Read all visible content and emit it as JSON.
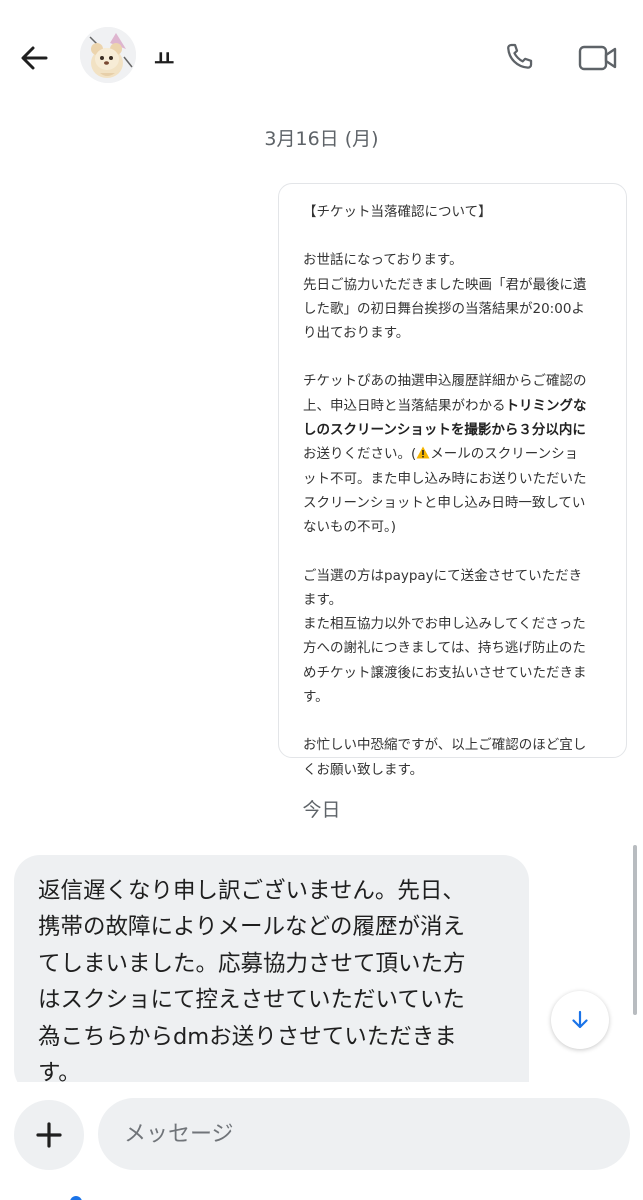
{
  "header": {
    "contact_name": "ㅛ",
    "back_icon": "arrow-left-icon",
    "call_icon": "phone-icon",
    "video_icon": "video-camera-icon"
  },
  "thread": {
    "date_1": "3月16日 (月)",
    "shared_message": {
      "title": "【チケット当落確認について】",
      "p1_l1": "お世話になっております。",
      "p1_l2": "先日ご協力いただきました映画「君が最後に遺",
      "p1_l3": "した歌」の初日舞台挨拶の当落結果が20:00よ",
      "p1_l4": "り出ております。",
      "p2_l1": "チケットぴあの抽選申込履歴詳細からご確認の",
      "p2_l2_a": "上、申込日時と当落結果がわかる",
      "p2_l2_b": "トリミングな",
      "p2_l3": "しのスクリーンショットを撮影から３分以内に",
      "p2_l4_a": "お送りください。(",
      "p2_l4_b": "メールのスクリーンショ",
      "p2_l5": "ット不可。また申し込み時にお送りいただいた",
      "p2_l6": "スクリーンショットと申し込み日時一致してい",
      "p2_l7": "ないもの不可。)",
      "p3_l1": "ご当選の方はpaypayにて送金させていただき",
      "p3_l2": "ます。",
      "p3_l3": "また相互協力以外でお申し込みしてくださった",
      "p3_l4": "方への謝礼につきましては、持ち逃げ防止のた",
      "p3_l5": "めチケット譲渡後にお支払いさせていただきま",
      "p3_l6": "す。",
      "p4_l1": "お忙しい中恐縮ですが、以上ご確認のほど宜し",
      "p4_l2": "くお願い致します。"
    },
    "date_2": "今日",
    "my_message": {
      "l1": "返信遅くなり申し訳ございません。先日、",
      "l2": "携帯の故障によりメールなどの履歴が消え",
      "l3": "てしまいました。応募協力させて頂いた方",
      "l4": "はスクショにて控えさせていただいていた",
      "l5": "為こちらからdmお送りさせていただきま",
      "l6": "す。"
    }
  },
  "composer": {
    "placeholder": "メッセージ",
    "value": "",
    "plus_icon": "plus-icon"
  },
  "scroll_down_icon": "arrow-down-icon",
  "colors": {
    "bubble_bg": "#eef0f2",
    "accent_blue": "#1a73e8",
    "icon_gray": "#5e6368"
  }
}
